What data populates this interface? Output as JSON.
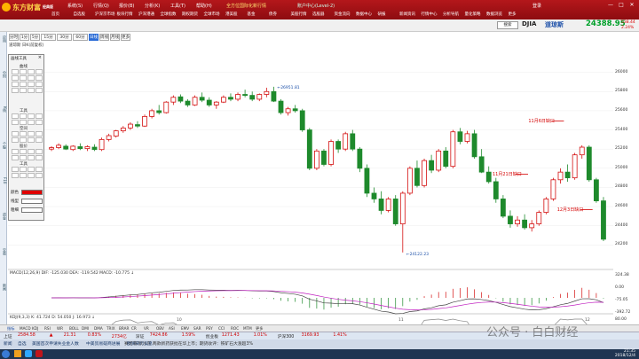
{
  "app": {
    "logo": "东方财富",
    "logo_sub": "经典版",
    "menus": [
      "系统(S)",
      "行情(Q)",
      "报价(B)",
      "分析(K)",
      "工具(T)",
      "帮助(H)"
    ],
    "promo": "全方位国际化新行情",
    "account": "账户中心(Level-2)",
    "account_short": "登录",
    "nav": [
      "首页",
      "自选股",
      "沪深京市场",
      "板块行情",
      "沪深港通",
      "全球指数",
      "期权期货",
      "全球市场",
      "港美股",
      "基金",
      "债券",
      "美股行情",
      "选股器",
      "资金流向",
      "数据中心",
      "研报",
      "新闻资讯",
      "行情中心",
      "分析导航",
      "量化策略",
      "数据浏览",
      "更多"
    ],
    "window_ctrls": [
      "—",
      "□",
      "✕"
    ]
  },
  "symbol": {
    "code": "DJIA",
    "name": "道琼斯",
    "price": "24388.95",
    "change": "538.44",
    "pct": "2.24%",
    "search_btn": "搜索"
  },
  "periods": [
    "分时",
    "1分",
    "5分",
    "15分",
    "30分",
    "60分",
    "日线",
    "周线",
    "月线",
    "更多"
  ],
  "active_period": "日线",
  "chart_header": "道琼斯 日K(前复权)",
  "drawing_panel": {
    "title": "画线工具",
    "sections": [
      "曲线",
      "工具",
      "空间",
      "股价",
      "工具"
    ],
    "labels": {
      "color": "颜色",
      "style": "线型",
      "width": "粗细"
    }
  },
  "left_tabs": [
    "应用",
    "分时",
    "K线",
    "个股",
    "F10",
    "资金",
    "交易",
    "新闻"
  ],
  "chart_data": [
    {
      "type": "candlestick",
      "title": "道琼斯 日K(前复权)",
      "ylim": [
        24000,
        26200
      ],
      "yticks": [
        26000,
        25800,
        25600,
        25400,
        25200,
        25000,
        24800,
        24600,
        24400,
        24200
      ],
      "xticks": [
        "10",
        "11",
        "12"
      ],
      "high_label": "26951.81",
      "low_label": "24122.23",
      "annotations": [
        "11月6日缺口",
        "11月21日缺口",
        "12月3日缺口"
      ],
      "candles": [
        [
          25200,
          25230,
          25180,
          25215
        ],
        [
          25215,
          25260,
          25200,
          25240
        ],
        [
          25230,
          25250,
          25190,
          25200
        ],
        [
          25195,
          25240,
          25180,
          25230
        ],
        [
          25225,
          25260,
          25190,
          25205
        ],
        [
          25205,
          25240,
          25180,
          25225
        ],
        [
          25220,
          25250,
          25180,
          25195
        ],
        [
          25195,
          25320,
          25180,
          25300
        ],
        [
          25300,
          25360,
          25280,
          25340
        ],
        [
          25335,
          25400,
          25320,
          25390
        ],
        [
          25390,
          25440,
          25370,
          25420
        ],
        [
          25420,
          25480,
          25400,
          25460
        ],
        [
          25455,
          25490,
          25420,
          25440
        ],
        [
          25440,
          25560,
          25430,
          25540
        ],
        [
          25540,
          25620,
          25520,
          25600
        ],
        [
          25600,
          25660,
          25560,
          25580
        ],
        [
          25580,
          25700,
          25570,
          25690
        ],
        [
          25690,
          25760,
          25660,
          25740
        ],
        [
          25745,
          25770,
          25680,
          25700
        ],
        [
          25700,
          25720,
          25640,
          25660
        ],
        [
          25660,
          25760,
          25650,
          25740
        ],
        [
          25740,
          25790,
          25690,
          25710
        ],
        [
          25710,
          25740,
          25640,
          25660
        ],
        [
          25660,
          25700,
          25620,
          25690
        ],
        [
          25690,
          25760,
          25680,
          25740
        ],
        [
          25740,
          25780,
          25700,
          25720
        ],
        [
          25720,
          25790,
          25700,
          25770
        ],
        [
          25770,
          25820,
          25740,
          25760
        ],
        [
          25760,
          25800,
          25700,
          25720
        ],
        [
          25720,
          25780,
          25700,
          25770
        ],
        [
          25770,
          25840,
          25740,
          25800
        ],
        [
          25800,
          25850,
          25690,
          25700
        ],
        [
          25700,
          25720,
          25560,
          25580
        ],
        [
          25580,
          25640,
          25550,
          25620
        ],
        [
          25620,
          25660,
          25580,
          25600
        ],
        [
          25600,
          25620,
          25380,
          25400
        ],
        [
          25400,
          25420,
          24980,
          25000
        ],
        [
          25000,
          25200,
          24980,
          25180
        ],
        [
          25180,
          25200,
          25020,
          25040
        ],
        [
          25040,
          25300,
          25020,
          25280
        ],
        [
          25280,
          25300,
          25160,
          25200
        ],
        [
          25200,
          25380,
          25180,
          25360
        ],
        [
          25360,
          25400,
          25180,
          25200
        ],
        [
          25200,
          25220,
          24960,
          25000
        ],
        [
          25000,
          25040,
          24700,
          24740
        ],
        [
          24740,
          24800,
          24640,
          24680
        ],
        [
          24680,
          24760,
          24520,
          24560
        ],
        [
          24560,
          24700,
          24540,
          24680
        ],
        [
          24680,
          24720,
          24400,
          24420
        ],
        [
          24420,
          24760,
          24122,
          24740
        ],
        [
          24740,
          25020,
          24720,
          25000
        ],
        [
          25000,
          25080,
          24800,
          24820
        ],
        [
          24820,
          25100,
          24800,
          25080
        ],
        [
          25080,
          25140,
          24950,
          24980
        ],
        [
          24980,
          25200,
          24960,
          25180
        ],
        [
          25180,
          25220,
          25000,
          25020
        ],
        [
          25020,
          25400,
          25000,
          25380
        ],
        [
          25380,
          25420,
          25250,
          25280
        ],
        [
          25280,
          25390,
          25260,
          25360
        ],
        [
          25360,
          25400,
          25100,
          25120
        ],
        [
          25120,
          25200,
          24950,
          24960
        ],
        [
          24960,
          25020,
          24840,
          24860
        ],
        [
          24860,
          24900,
          24640,
          24680
        ],
        [
          24680,
          24720,
          24480,
          24500
        ],
        [
          24500,
          24560,
          24380,
          24420
        ],
        [
          24420,
          24500,
          24390,
          24460
        ],
        [
          24460,
          24520,
          24360,
          24380
        ],
        [
          24380,
          24460,
          24340,
          24420
        ],
        [
          24420,
          24560,
          24400,
          24540
        ],
        [
          24540,
          24700,
          24520,
          24680
        ],
        [
          24680,
          24900,
          24660,
          24880
        ],
        [
          24880,
          25000,
          24840,
          24960
        ],
        [
          24960,
          25040,
          24860,
          24900
        ],
        [
          24900,
          25160,
          24880,
          25140
        ],
        [
          25140,
          25240,
          25100,
          25220
        ],
        [
          25220,
          25240,
          24860,
          24880
        ],
        [
          24880,
          24900,
          24640,
          24660
        ],
        [
          24660,
          24700,
          24240,
          24260
        ]
      ]
    },
    {
      "type": "line",
      "title": "MACD(12,26,9)",
      "readout": "DIF: -125.030  DEA: -119.542  MACD: -10.775 ↓",
      "yticks": [
        "324.38",
        "0.00",
        "-75.05",
        "-392.72"
      ]
    },
    {
      "type": "line",
      "title": "KDJ(9,3,3)",
      "readout": "K: 41.724  D: 54.050  J: 16.973 ↓",
      "yticks": [
        "80.00",
        "50.00",
        "20.00",
        "-12.03"
      ]
    }
  ],
  "indicator_tabs": [
    "指标",
    "MACD",
    "KDJ",
    "RSI",
    "WR",
    "BOLL",
    "DMI",
    "DMA",
    "TRIX",
    "BRAR",
    "CR",
    "VR",
    "OBV",
    "ASI",
    "EMV",
    "SAR",
    "PSY",
    "CCI",
    "ROC",
    "MTM",
    "更多"
  ],
  "status_row1": {
    "items": [
      "上证",
      "2584.58",
      "▲",
      "21.31",
      "0.83%",
      "2734亿",
      "深证",
      "7424.86",
      "1.59%",
      "创业板",
      "1271.43",
      "1.01%",
      "沪深300",
      "3169.93",
      "1.41%"
    ],
    "news": "赛诺菲/默沙东 两款新药获批在华上市；期货收评：铁矿石大涨超3%"
  },
  "status_row2": {
    "items": [
      "新闻",
      "自选",
      "美国首次申请失业金人数",
      "中美贸易磋商进展",
      "欧洲央行议息"
    ]
  },
  "taskbar": {
    "time": "21:35",
    "date": "2018/12/4"
  },
  "watermark": "公众号 · 白白财经"
}
